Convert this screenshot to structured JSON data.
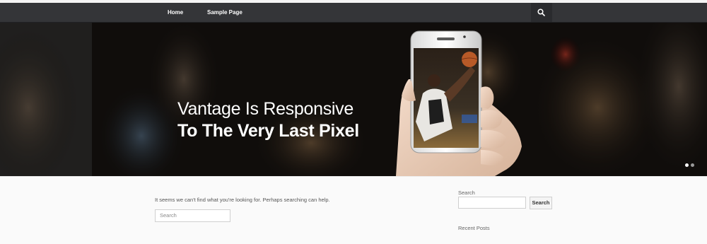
{
  "nav": {
    "items": [
      {
        "label": "Home"
      },
      {
        "label": "Sample Page"
      }
    ],
    "search_icon": "search-icon"
  },
  "hero": {
    "line1": "Vantage Is Responsive",
    "line2": "To The Very Last Pixel",
    "slides": 2,
    "active_slide": 1
  },
  "content": {
    "not_found_text": "It seems we can't find what you're looking for. Perhaps searching can help.",
    "search_placeholder": "Search"
  },
  "sidebar": {
    "search_title": "Search",
    "search_button": "Search",
    "recent_posts_title": "Recent Posts"
  },
  "colors": {
    "navbar": "#343538",
    "page_bg": "#fafafa",
    "accent_white": "#ffffff"
  }
}
